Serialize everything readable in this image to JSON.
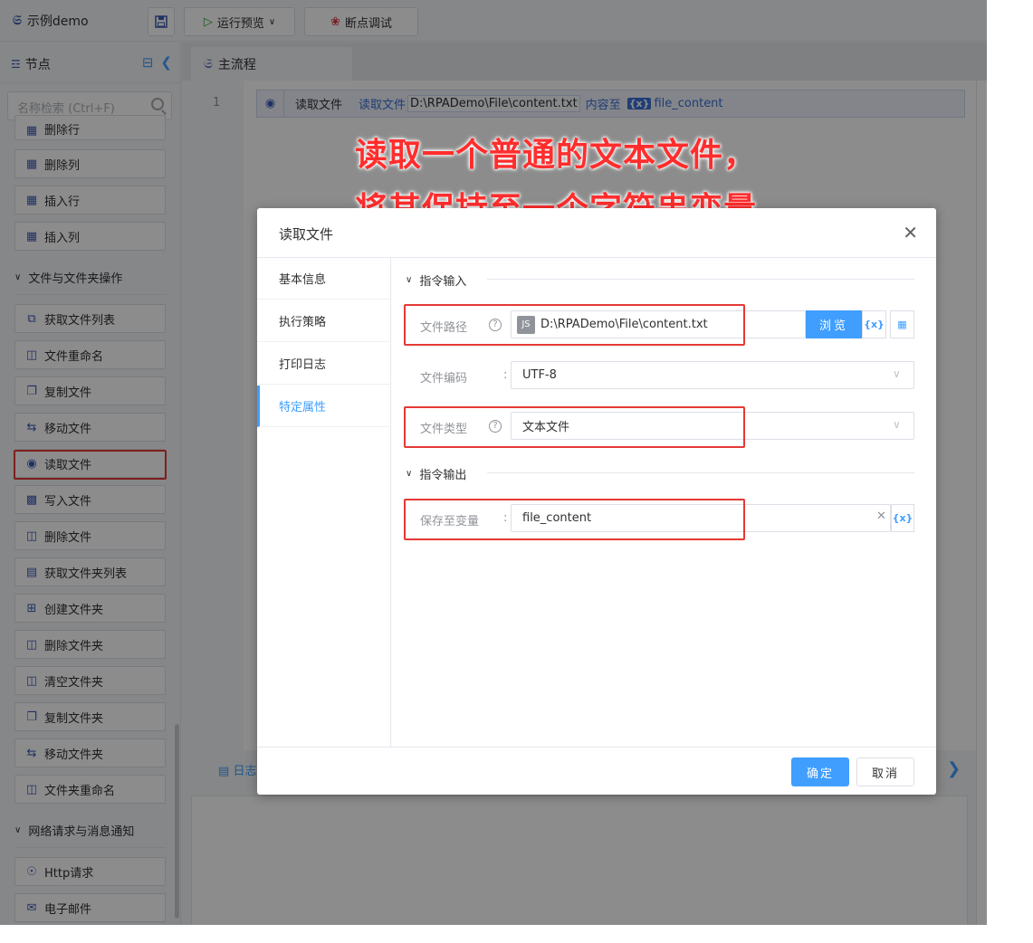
{
  "app": {
    "title": "示例demo"
  },
  "toolbar": {
    "run_preview": "运行预览",
    "debug": "断点调试"
  },
  "left": {
    "header": "节点",
    "search_placeholder": "名称检索 (Ctrl+F)",
    "partial_item": "删除行",
    "table_items": [
      "删除列",
      "插入行",
      "插入列"
    ],
    "group_file": "文件与文件夹操作",
    "file_items": [
      "获取文件列表",
      "文件重命名",
      "复制文件",
      "移动文件",
      "读取文件",
      "写入文件",
      "删除文件",
      "获取文件夹列表",
      "创建文件夹",
      "删除文件夹",
      "清空文件夹",
      "复制文件夹",
      "移动文件夹",
      "文件夹重命名"
    ],
    "group_net": "网络请求与消息通知",
    "net_items": [
      "Http请求",
      "电子邮件"
    ]
  },
  "editor": {
    "tab": "主流程",
    "line_number": "1",
    "cmd": {
      "name": "读取文件",
      "k1": "读取文件",
      "v1": "D:\\RPADemo\\File\\content.txt",
      "k2": "内容至",
      "var_badge": "{x}",
      "v2": "file_content"
    }
  },
  "bottom": {
    "log_tab": "日志"
  },
  "annotation": {
    "line1": "读取一个普通的文本文件，",
    "line2": "将其保持至一个字符串变量"
  },
  "dialog": {
    "title": "读取文件",
    "side": [
      "基本信息",
      "执行策略",
      "打印日志",
      "特定属性"
    ],
    "active_side": "特定属性",
    "section_input": "指令输入",
    "section_output": "指令输出",
    "fields": {
      "path_label": "文件路径",
      "path_value": "D:\\RPADemo\\File\\content.txt",
      "path_type_badge": "JS",
      "browse": "浏览",
      "var_btn": "{x}",
      "encoding_label": "文件编码",
      "encoding_value": "UTF-8",
      "filetype_label": "文件类型",
      "filetype_value": "文本文件",
      "save_label": "保存至变量",
      "save_value": "file_content"
    },
    "ok": "确定",
    "cancel": "取消"
  },
  "colors": {
    "accent": "#409eff",
    "highlight": "#e53935",
    "annotation": "#ff2d2d"
  }
}
